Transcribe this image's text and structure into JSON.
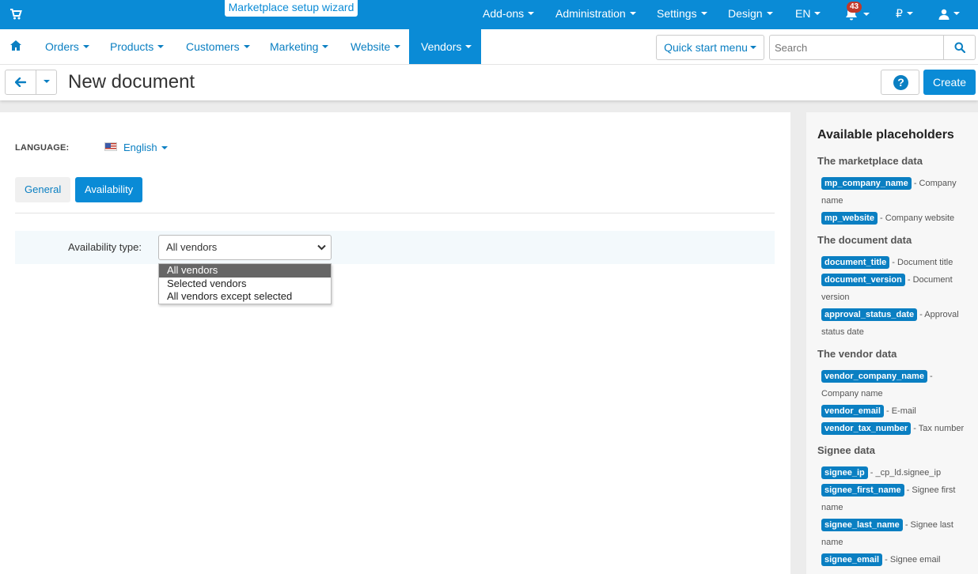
{
  "topbar": {
    "wizard": "Marketplace setup wizard",
    "addons": "Add-ons",
    "administration": "Administration",
    "settings": "Settings",
    "design": "Design",
    "language": "EN",
    "notifications": "43",
    "currency": "₽"
  },
  "nav": {
    "orders": "Orders",
    "products": "Products",
    "customers": "Customers",
    "marketing": "Marketing",
    "website": "Website",
    "vendors": "Vendors",
    "quick_start": "Quick start menu",
    "search_placeholder": "Search"
  },
  "titlebar": {
    "title": "New document",
    "help": "?",
    "create": "Create"
  },
  "form": {
    "language_label": "LANGUAGE:",
    "language_value": "English",
    "tab_general": "General",
    "tab_availability": "Availability",
    "availability_label": "Availability type:",
    "availability_value": "All vendors",
    "options": [
      "All vendors",
      "Selected vendors",
      "All vendors except selected"
    ]
  },
  "placeholders": {
    "title": "Available placeholders",
    "groups": [
      {
        "title": "The marketplace data",
        "items": [
          {
            "key": "mp_company_name",
            "desc": " - Company name"
          },
          {
            "key": "mp_website",
            "desc": " - Company website"
          }
        ]
      },
      {
        "title": "The document data",
        "items": [
          {
            "key": "document_title",
            "desc": " - Document title"
          },
          {
            "key": "document_version",
            "desc": " - Document version"
          },
          {
            "key": "approval_status_date",
            "desc": " - Approval status date"
          }
        ]
      },
      {
        "title": "The vendor data",
        "items": [
          {
            "key": "vendor_company_name",
            "desc": " - Company name"
          },
          {
            "key": "vendor_email",
            "desc": " - E-mail"
          },
          {
            "key": "vendor_tax_number",
            "desc": " - Tax number"
          }
        ]
      },
      {
        "title": "Signee data",
        "items": [
          {
            "key": "signee_ip",
            "desc": " - _cp_ld.signee_ip"
          },
          {
            "key": "signee_first_name",
            "desc": " - Signee first name"
          },
          {
            "key": "signee_last_name",
            "desc": " - Signee last name"
          },
          {
            "key": "signee_email",
            "desc": " - Signee email"
          }
        ]
      }
    ]
  }
}
